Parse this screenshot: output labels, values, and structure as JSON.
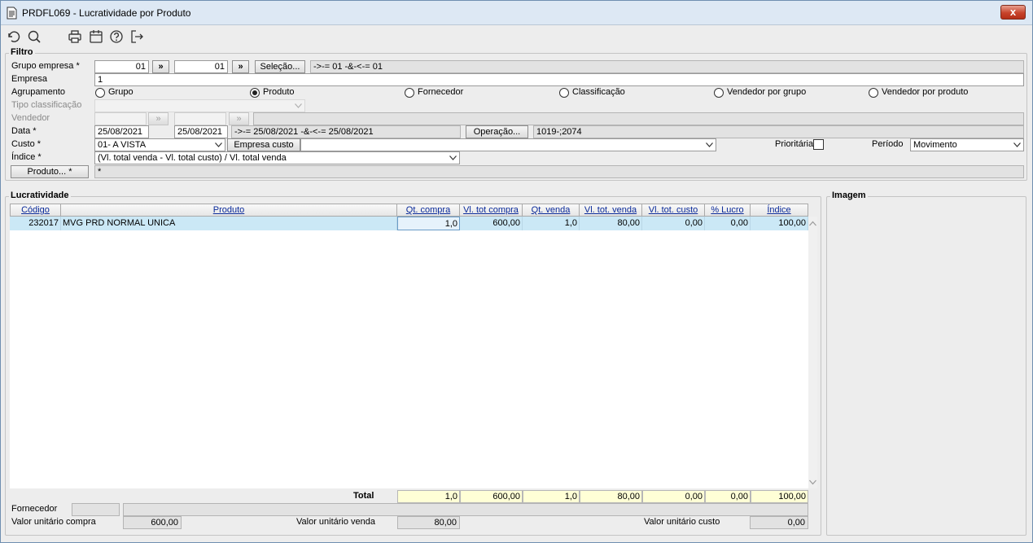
{
  "window": {
    "title": "PRDFL069 - Lucratividade por Produto",
    "close_label": "x"
  },
  "toolbar": {
    "icons": [
      "undo-icon",
      "search-icon",
      "print-icon",
      "calendar-icon",
      "help-icon",
      "exit-icon"
    ]
  },
  "filtro": {
    "legend": "Filtro",
    "grupo_empresa": {
      "label": "Grupo empresa *",
      "from": "01",
      "to": "01",
      "arrow_label": "»",
      "selecao_label": "Seleção...",
      "summary": "->-= 01 -&-<-= 01"
    },
    "empresa": {
      "label": "Empresa",
      "value": "1"
    },
    "agrupamento": {
      "label": "Agrupamento",
      "options": [
        "Grupo",
        "Produto",
        "Fornecedor",
        "Classificação",
        "Vendedor por grupo",
        "Vendedor por produto"
      ],
      "selected": "Produto"
    },
    "tipo_classificacao": {
      "label": "Tipo classificação",
      "value": ""
    },
    "vendedor": {
      "label": "Vendedor",
      "from": "",
      "to": "",
      "arrow_label": "»"
    },
    "data": {
      "label": "Data *",
      "from": "25/08/2021",
      "to": "25/08/2021",
      "summary": "->-= 25/08/2021 -&-<-= 25/08/2021",
      "operacao_label": "Operação...",
      "operacao_value": "1019-;2074"
    },
    "custo": {
      "label": "Custo *",
      "value": "01- A VISTA",
      "empresa_custo_label": "Empresa custo",
      "empresa_custo_value": "",
      "prioritaria_label": "Prioritária",
      "periodo_label": "Período",
      "periodo_value": "Movimento"
    },
    "indice": {
      "label": "Índice *",
      "value": "(Vl. total venda - Vl. total custo) / Vl. total venda"
    },
    "produto": {
      "button_label": "Produto... *",
      "value": "*"
    }
  },
  "lucratividade": {
    "legend": "Lucratividade",
    "columns": [
      "Código",
      "Produto",
      "Qt. compra",
      "Vl. tot compra",
      "Qt. venda",
      "Vl. tot. venda",
      "Vl. tot. custo",
      "% Lucro",
      "Índice"
    ],
    "rows": [
      [
        "232017",
        "MVG PRD NORMAL UNICA",
        "1,0",
        "600,00",
        "1,0",
        "80,00",
        "0,00",
        "0,00",
        "100,00"
      ]
    ],
    "total": {
      "label": "Total",
      "values": [
        "1,0",
        "600,00",
        "1,0",
        "80,00",
        "0,00",
        "0,00",
        "100,00"
      ]
    },
    "fornecedor": {
      "label": "Fornecedor",
      "code": "",
      "name": ""
    },
    "valor_unitario_compra": {
      "label": "Valor unitário compra",
      "value": "600,00"
    },
    "valor_unitario_venda": {
      "label": "Valor unitário venda",
      "value": "80,00"
    },
    "valor_unitario_custo": {
      "label": "Valor unitário custo",
      "value": "0,00"
    }
  },
  "imagem": {
    "legend": "Imagem"
  }
}
